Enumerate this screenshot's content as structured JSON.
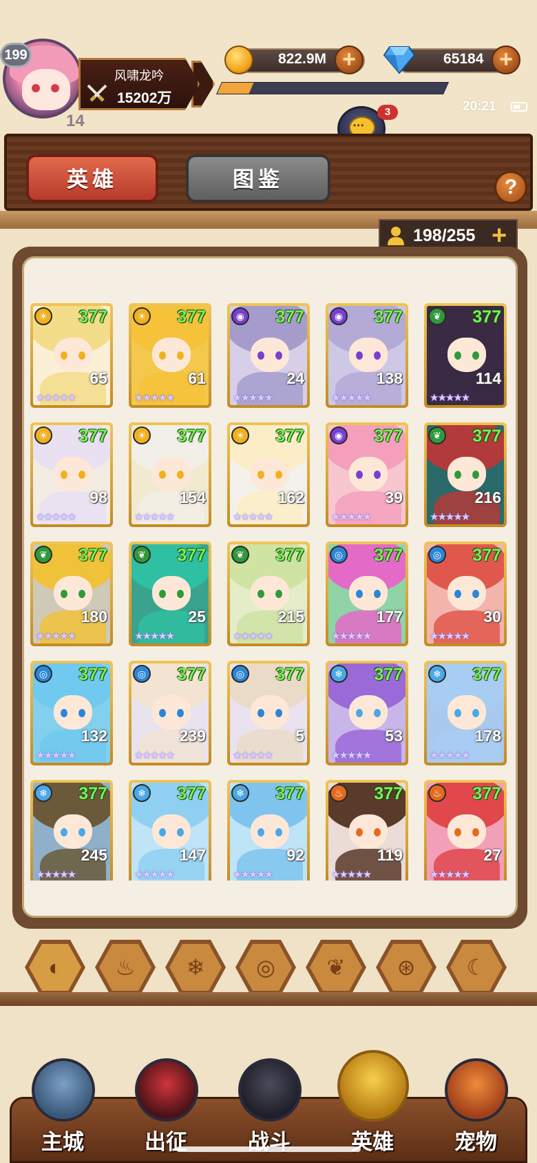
{
  "player": {
    "level": "199",
    "vip": "14",
    "name": "风啸龙吟",
    "power": "15202万"
  },
  "resources": {
    "gold": "822.9M",
    "gems": "65184",
    "exp_progress": 0.14
  },
  "status": {
    "time": "20:21"
  },
  "chat": {
    "label": "聊天",
    "badge": "3"
  },
  "tabs": {
    "heroes": "英雄",
    "codex": "图鉴",
    "help": "?"
  },
  "capacity": {
    "text": "198/255",
    "plus": "+"
  },
  "colors": {
    "gold": "#f3a51e",
    "level_green": "#7bf05a",
    "accent_red": "#c9422f"
  },
  "heroes": [
    {
      "level": "377",
      "count": "65",
      "stars": "★★★★★",
      "element": "light"
    },
    {
      "level": "377",
      "count": "61",
      "stars": "★★★★★",
      "element": "light"
    },
    {
      "level": "377",
      "count": "24",
      "stars": "★★★★★",
      "element": "dark"
    },
    {
      "level": "377",
      "count": "138",
      "stars": "★★★★★",
      "element": "dark"
    },
    {
      "level": "377",
      "count": "114",
      "stars": "★★★★★",
      "element": "wood"
    },
    {
      "level": "377",
      "count": "98",
      "stars": "★★★★★",
      "element": "light"
    },
    {
      "level": "377",
      "count": "154",
      "stars": "★★★★★",
      "element": "light"
    },
    {
      "level": "377",
      "count": "162",
      "stars": "★★★★★",
      "element": "light"
    },
    {
      "level": "377",
      "count": "39",
      "stars": "★★★★★",
      "element": "dark"
    },
    {
      "level": "377",
      "count": "216",
      "stars": "★★★★★",
      "element": "wood"
    },
    {
      "level": "377",
      "count": "180",
      "stars": "★★★★★",
      "element": "wood"
    },
    {
      "level": "377",
      "count": "25",
      "stars": "★★★★★",
      "element": "wood"
    },
    {
      "level": "377",
      "count": "215",
      "stars": "★★★★★",
      "element": "wood"
    },
    {
      "level": "377",
      "count": "177",
      "stars": "★★★★★",
      "element": "water"
    },
    {
      "level": "377",
      "count": "30",
      "stars": "★★★★★",
      "element": "water"
    },
    {
      "level": "377",
      "count": "132",
      "stars": "★★★★★",
      "element": "water"
    },
    {
      "level": "377",
      "count": "239",
      "stars": "★★★★★",
      "element": "water"
    },
    {
      "level": "377",
      "count": "5",
      "stars": "★★★★★",
      "element": "water"
    },
    {
      "level": "377",
      "count": "53",
      "stars": "★★★★★",
      "element": "ice"
    },
    {
      "level": "377",
      "count": "178",
      "stars": "★★★★★",
      "element": "ice"
    },
    {
      "level": "377",
      "count": "245",
      "stars": "★★★★★",
      "element": "ice"
    },
    {
      "level": "377",
      "count": "147",
      "stars": "★★★★★",
      "element": "ice"
    },
    {
      "level": "377",
      "count": "92",
      "stars": "★★★★★",
      "element": "ice"
    },
    {
      "level": "377",
      "count": "119",
      "stars": "★★★★★",
      "element": "fire"
    },
    {
      "level": "377",
      "count": "27",
      "stars": "★★★★★",
      "element": "fire"
    }
  ],
  "element_filters": [
    {
      "name": "all",
      "icon": "◐"
    },
    {
      "name": "fire",
      "icon": "♨"
    },
    {
      "name": "ice",
      "icon": "❄"
    },
    {
      "name": "water",
      "icon": "◎"
    },
    {
      "name": "wood",
      "icon": "❦"
    },
    {
      "name": "dark",
      "icon": "⊛"
    },
    {
      "name": "light",
      "icon": "☾"
    }
  ],
  "nav": [
    {
      "label": "主城",
      "icon": "castle-icon"
    },
    {
      "label": "出征",
      "icon": "expedition-icon"
    },
    {
      "label": "战斗",
      "icon": "battle-icon"
    },
    {
      "label": "英雄",
      "icon": "hero-icon"
    },
    {
      "label": "宠物",
      "icon": "pet-icon"
    }
  ]
}
